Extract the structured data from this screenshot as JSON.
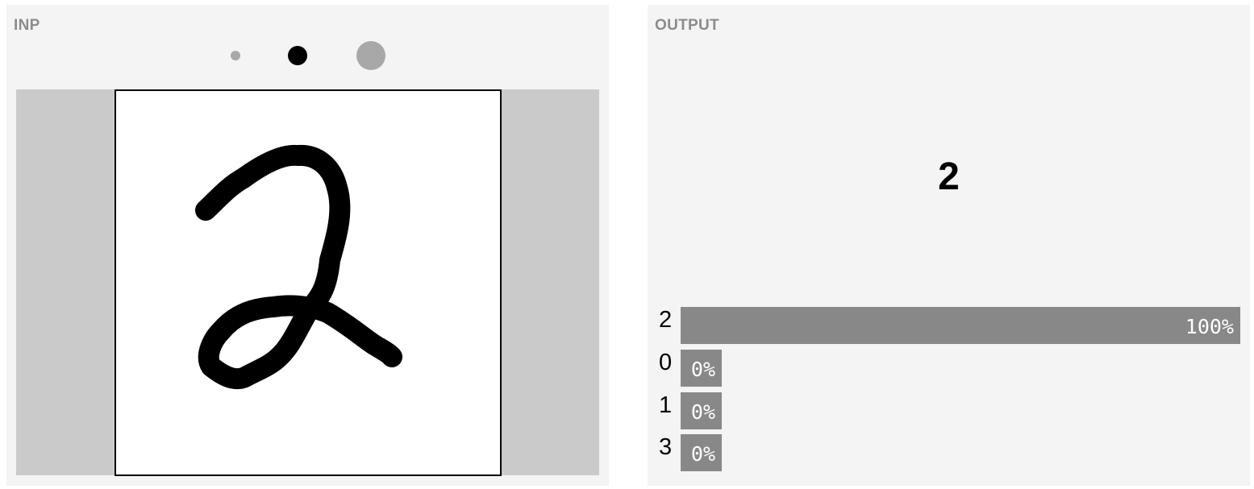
{
  "input": {
    "title": "INP",
    "brushes": [
      {
        "name": "small",
        "color": "#a8a8a8",
        "selected": false
      },
      {
        "name": "medium",
        "color": "#000000",
        "selected": true
      },
      {
        "name": "large",
        "color": "#a8a8a8",
        "selected": false
      }
    ],
    "canvas": {
      "background": "#ffffff",
      "stroke_color": "#000000",
      "drawing": "handwritten digit 2"
    }
  },
  "output": {
    "title": "OUTPUT",
    "prediction": "2",
    "confidences": [
      {
        "label": "2",
        "value": 1.0,
        "value_text": "100%"
      },
      {
        "label": "0",
        "value": 0.0,
        "value_text": "0%"
      },
      {
        "label": "1",
        "value": 0.0,
        "value_text": "0%"
      },
      {
        "label": "3",
        "value": 0.0,
        "value_text": "0%"
      }
    ],
    "bar_color": "#888888"
  }
}
